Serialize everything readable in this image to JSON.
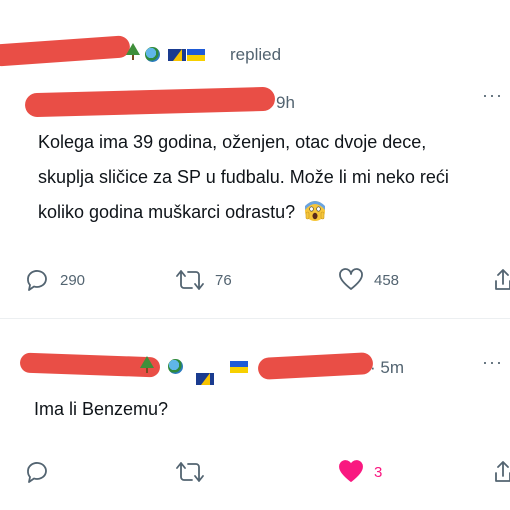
{
  "post": {
    "replied_label": "replied",
    "time": "9h",
    "more": "···",
    "text_line1": "Kolega ima 39 godina, oženjen, otac dvoje dece,",
    "text_line2": "skuplja sličice za SP u fudbalu. Može li mi neko reći",
    "text_line3": "koliko godina muškarci odrastu?",
    "reply_count": "290",
    "retweet_count": "76",
    "like_count": "458"
  },
  "reply": {
    "time": "· 5m",
    "more": "···",
    "text": "Ima li Benzemu?",
    "like_count": "3"
  },
  "colors": {
    "redaction": "#e8453c",
    "text": "#0f1419",
    "muted": "#536471",
    "liked": "#f91880"
  },
  "icons": [
    "tree-emoji-icon",
    "globe-emoji-icon",
    "flag-bosnia-icon",
    "flag-ukraine-icon",
    "screaming-face-icon",
    "reply-icon",
    "retweet-icon",
    "like-icon",
    "share-icon",
    "more-icon"
  ]
}
